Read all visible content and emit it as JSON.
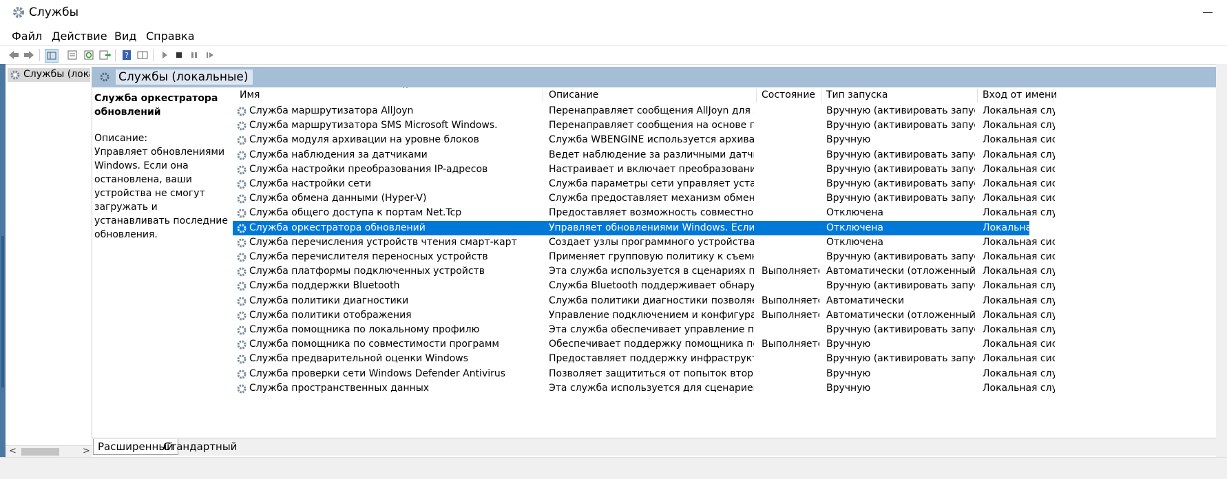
{
  "window": {
    "title": "Службы"
  },
  "menu": [
    "Файл",
    "Действие",
    "Вид",
    "Справка"
  ],
  "tree": {
    "item": "Службы (лока"
  },
  "pane": {
    "title": "Службы (локальные)"
  },
  "description": {
    "service_name": "Служба оркестратора обновлений",
    "label": "Описание:",
    "text": "Управляет обновлениями Windows. Если она остановлена, ваши устройства не смогут загружать и устанавливать последние обновления."
  },
  "columns": [
    "Имя",
    "Описание",
    "Состояние",
    "Тип запуска",
    "Вход от имени"
  ],
  "selected_index": 8,
  "rows": [
    [
      "Служба маршрутизатора AllJoyn",
      "Перенаправляет сообщения AllJoyn для локал...",
      "",
      "Вручную (активировать запуск)",
      "Локальная слу..."
    ],
    [
      "Служба маршрутизатора SMS Microsoft Windows.",
      "Перенаправляет сообщения на основе прави...",
      "",
      "Вручную (активировать запуск)",
      "Локальная слу..."
    ],
    [
      "Служба модуля архивации на уровне блоков",
      "Служба WBENGINE используется архивацией д...",
      "",
      "Вручную",
      "Локальная сис..."
    ],
    [
      "Служба наблюдения за датчиками",
      "Ведет наблюдение за различными датчиками ...",
      "",
      "Вручную (активировать запуск)",
      "Локальная слу..."
    ],
    [
      "Служба настройки преобразования IP-адресов",
      "Настраивает и включает преобразование из v...",
      "",
      "Вручную (активировать запуск)",
      "Локальная сис..."
    ],
    [
      "Служба настройки сети",
      "Служба параметры сети управляет установкой...",
      "",
      "Вручную (активировать запуск)",
      "Локальная сис..."
    ],
    [
      "Служба обмена данными (Hyper-V)",
      "Служба предоставляет механизм обмена данн...",
      "",
      "Вручную (активировать запуск)",
      "Локальная сис..."
    ],
    [
      "Служба общего доступа к портам Net.Tcp",
      "Предоставляет возможность совместного исп...",
      "",
      "Отключена",
      "Локальная слу..."
    ],
    [
      "Служба оркестратора обновлений",
      "Управляет обновлениями Windows. Если она о...",
      "",
      "Отключена",
      "Локальная сис..."
    ],
    [
      "Служба перечисления устройств чтения смарт-карт",
      "Создает узлы программного устройства для вс...",
      "",
      "Отключена",
      "Локальная сис..."
    ],
    [
      "Служба перечислителя переносных устройств",
      "Применяет групповую политику к съемным за...",
      "",
      "Вручную (активировать запуск)",
      "Локальная сис..."
    ],
    [
      "Служба платформы подключенных устройств",
      "Эта служба используется в сценариях платфор...",
      "Выполняется",
      "Автоматически (отложенный зап...",
      "Локальная слу..."
    ],
    [
      "Служба поддержки Bluetooth",
      "Служба Bluetooth поддерживает обнаружение ...",
      "",
      "Вручную (активировать запуск)",
      "Локальная слу..."
    ],
    [
      "Служба политики диагностики",
      "Служба политики диагностики позволяет обна...",
      "Выполняется",
      "Автоматически",
      "Локальная слу..."
    ],
    [
      "Служба политики отображения",
      "Управление подключением и конфигурацией ...",
      "Выполняется",
      "Автоматически (отложенный зап...",
      "Локальная слу..."
    ],
    [
      "Служба помощника по локальному профилю",
      "Эта служба обеспечивает управление профил...",
      "",
      "Вручную (активировать запуск)",
      "Локальная слу..."
    ],
    [
      "Служба помощника по совместимости программ",
      "Обеспечивает поддержку помощника по совм...",
      "Выполняется",
      "Вручную",
      "Локальная сис..."
    ],
    [
      "Служба предварительной оценки Windows",
      "Предоставляет поддержку инфраструктуры для...",
      "",
      "Вручную (активировать запуск)",
      "Локальная сис..."
    ],
    [
      "Служба проверки сети Windows Defender Antivirus",
      "Позволяет защититься от попыток вторжения, ...",
      "",
      "Вручную",
      "Локальная слу..."
    ],
    [
      "Служба пространственных данных",
      "Эта служба используется для сценариев прост...",
      "",
      "Вручную",
      "Локальная слу..."
    ]
  ],
  "tabs": [
    "Расширенный",
    "Стандартный"
  ],
  "colors": {
    "selection": "#0078d7",
    "pane_header": "#a6bdd6"
  },
  "icons": [
    "gear-icon",
    "back-arrow-icon",
    "forward-arrow-icon",
    "play-icon",
    "stop-icon",
    "pause-icon",
    "restart-icon",
    "help-icon"
  ]
}
